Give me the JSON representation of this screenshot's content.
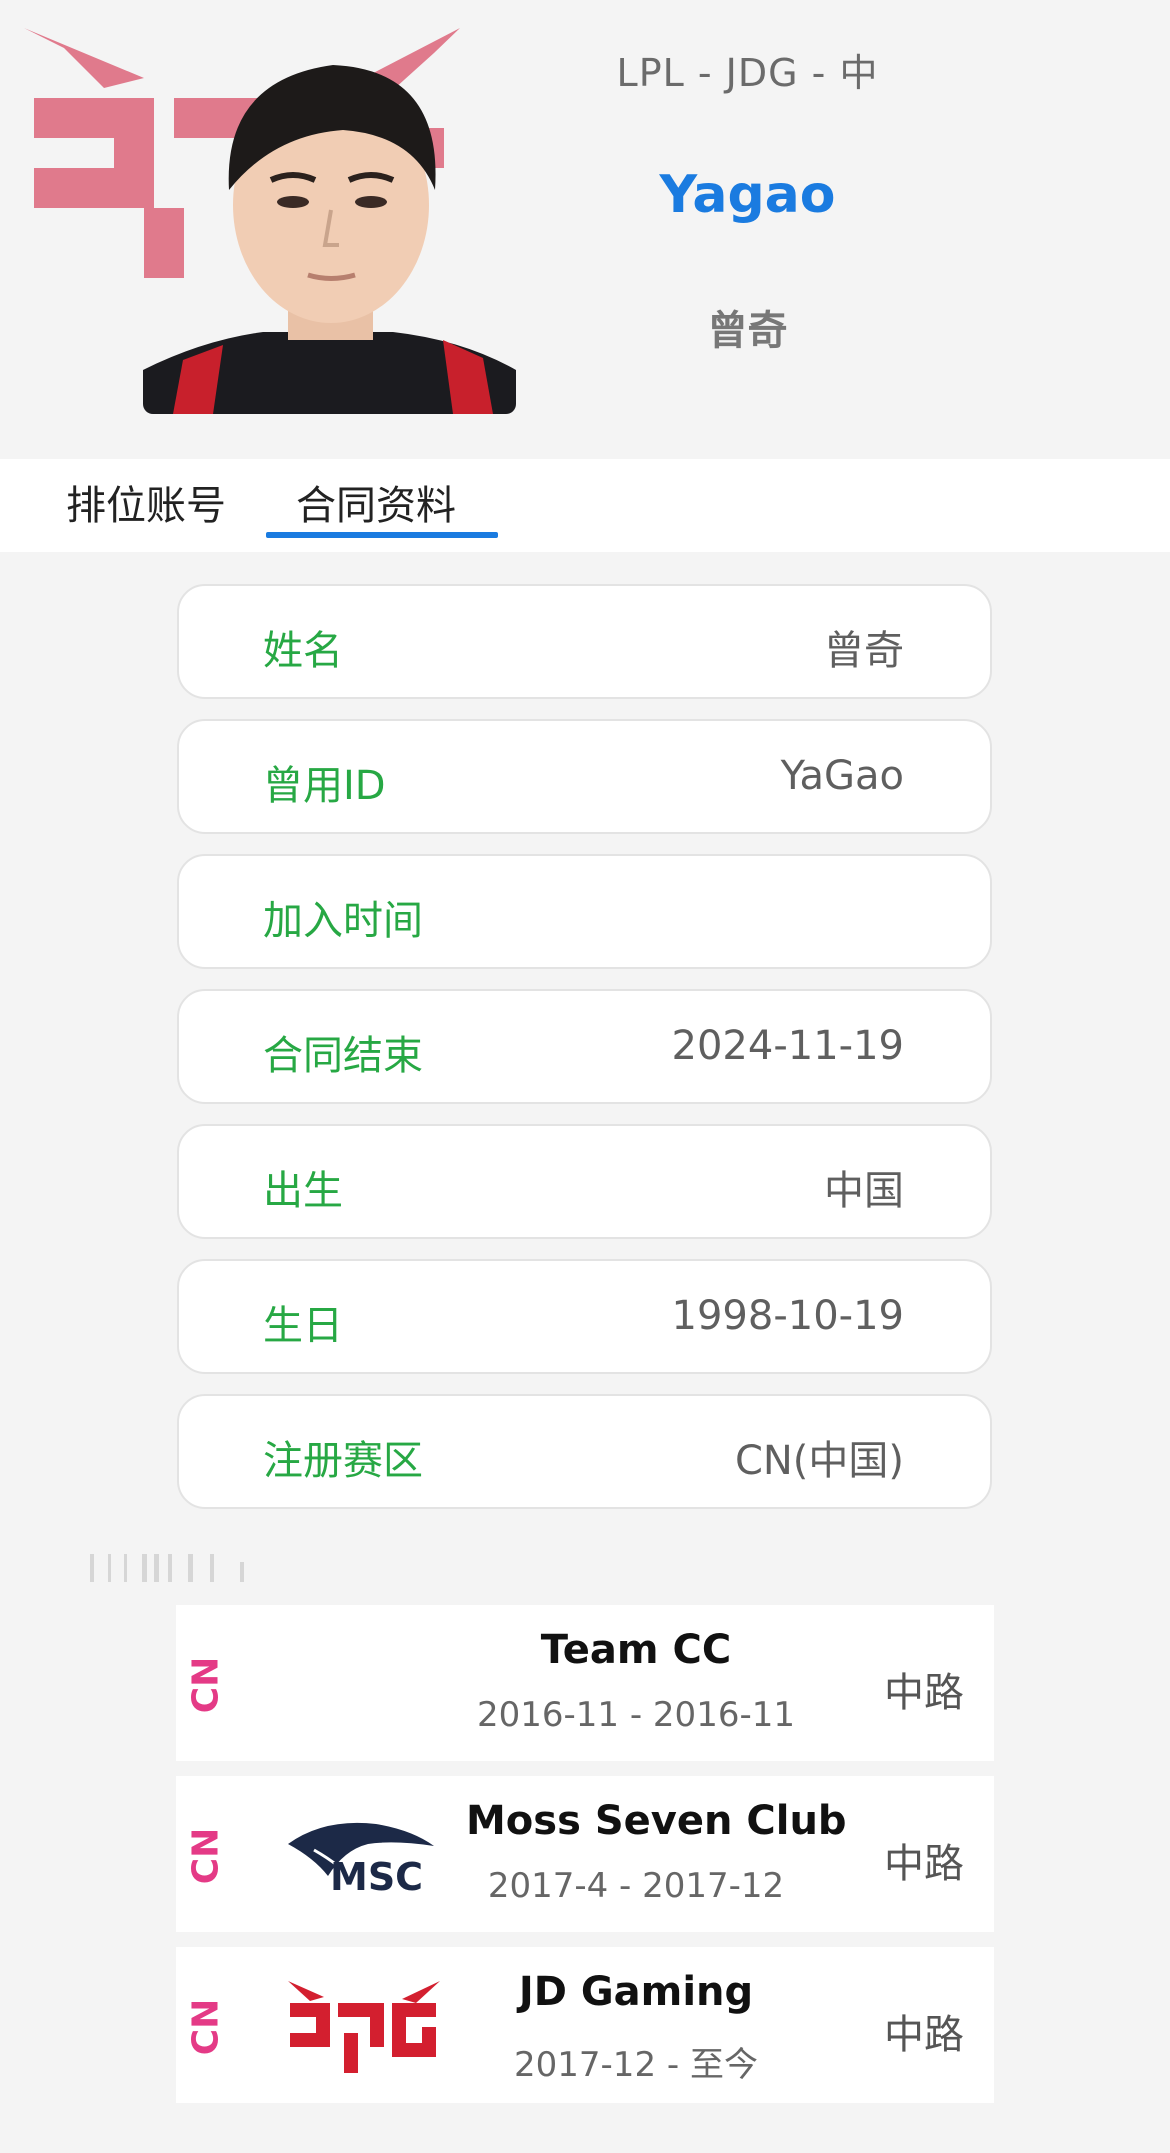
{
  "header": {
    "league_line": "LPL - JDG - 中",
    "player_id": "Yagao",
    "real_name": "曾奇"
  },
  "tabs": [
    {
      "label": "排位账号",
      "active": false
    },
    {
      "label": "合同资料",
      "active": true
    }
  ],
  "info": [
    {
      "label": "姓名",
      "value": "曾奇"
    },
    {
      "label": "曾用ID",
      "value": "YaGao"
    },
    {
      "label": "加入时间",
      "value": ""
    },
    {
      "label": "合同结束",
      "value": "2024-11-19"
    },
    {
      "label": "出生",
      "value": "中国"
    },
    {
      "label": "生日",
      "value": "1998-10-19"
    },
    {
      "label": "注册赛区",
      "value": "CN(中国)"
    }
  ],
  "career": [
    {
      "region": "CN",
      "team": "Team CC",
      "period": "2016-11 - 2016-11",
      "role": "中路",
      "logo": "none"
    },
    {
      "region": "CN",
      "team": "Moss Seven Club",
      "period": "2017-4 - 2017-12",
      "role": "中路",
      "logo": "msc-logo"
    },
    {
      "region": "CN",
      "team": "JD Gaming",
      "period": "2017-12 - 至今",
      "role": "中路",
      "logo": "jdg-logo"
    }
  ],
  "colors": {
    "accent_blue": "#1a7be0",
    "label_green": "#27a844",
    "region_pink": "#e43a86",
    "jdg_red": "#d31f2f",
    "jdg_pink_bg": "#e07a8c"
  }
}
